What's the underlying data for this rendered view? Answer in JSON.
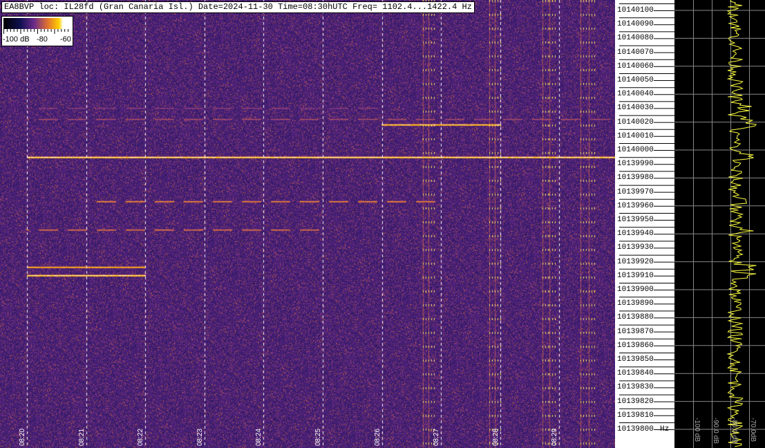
{
  "header": {
    "title": "EA8BVP loc: IL28fd (Gran Canaria Isl.) Date=2024-11-30 Time=08:30hUTC Freq= 1102.4...1422.4 Hz"
  },
  "colorbar": {
    "labels": [
      "-100 dB",
      "-80",
      "-60"
    ],
    "colors": [
      "#000000",
      "#101050",
      "#6a2a8a",
      "#e07030",
      "#ffd000",
      "#ffffff"
    ]
  },
  "chart_data": {
    "type": "heatmap",
    "title": "EA8BVP loc: IL28fd (Gran Canaria Isl.) Date=2024-11-30 Time=08:30hUTC Freq= 1102.4...1422.4 Hz",
    "x_ticks": [
      "08:20",
      "08:21",
      "08:22",
      "08:23",
      "08:24",
      "08:25",
      "08:26",
      "08:27",
      "08:28",
      "08:29"
    ],
    "y_ticks": [
      "10140100",
      "10140090",
      "10140080",
      "10140070",
      "10140060",
      "10140050",
      "10140040",
      "10140030",
      "10140020",
      "10140010",
      "10140000",
      "10139990",
      "10139980",
      "10139970",
      "10139960",
      "10139950",
      "10139940",
      "10139930",
      "10139920",
      "10139910",
      "10139900",
      "10139890",
      "10139880",
      "10139870",
      "10139860",
      "10139850",
      "10139840",
      "10139830",
      "10139820",
      "10139810",
      "10139800"
    ],
    "y_unit": "Hz",
    "ylim": [
      10139790,
      10140107
    ],
    "grid": true,
    "zlim_db": [
      -100,
      -60
    ],
    "signals": [
      {
        "freq": 10139995,
        "from": "08:20",
        "to": "08:30",
        "level": 0.95
      },
      {
        "freq": 10140022,
        "from": "08:20",
        "to": "08:30",
        "level": 0.6
      },
      {
        "freq": 10140030,
        "from": "08:20",
        "to": "08:26",
        "level": 0.55
      },
      {
        "freq": 10140018,
        "from": "08:26",
        "to": "08:28",
        "level": 0.9
      },
      {
        "freq": 10139963,
        "from": "08:21",
        "to": "08:27",
        "level": 0.75
      },
      {
        "freq": 10139943,
        "from": "08:20",
        "to": "08:25",
        "level": 0.7
      },
      {
        "freq": 10139910,
        "from": "08:20",
        "to": "08:22",
        "level": 0.95
      },
      {
        "freq": 10139916,
        "from": "08:20",
        "to": "08:22",
        "level": 0.85
      }
    ]
  },
  "spectrum": {
    "db_labels": [
      "-100 dB",
      "-90.0 dB",
      "-80.0 dB",
      "-70.0dB"
    ],
    "trace_color": "#ffff40"
  }
}
